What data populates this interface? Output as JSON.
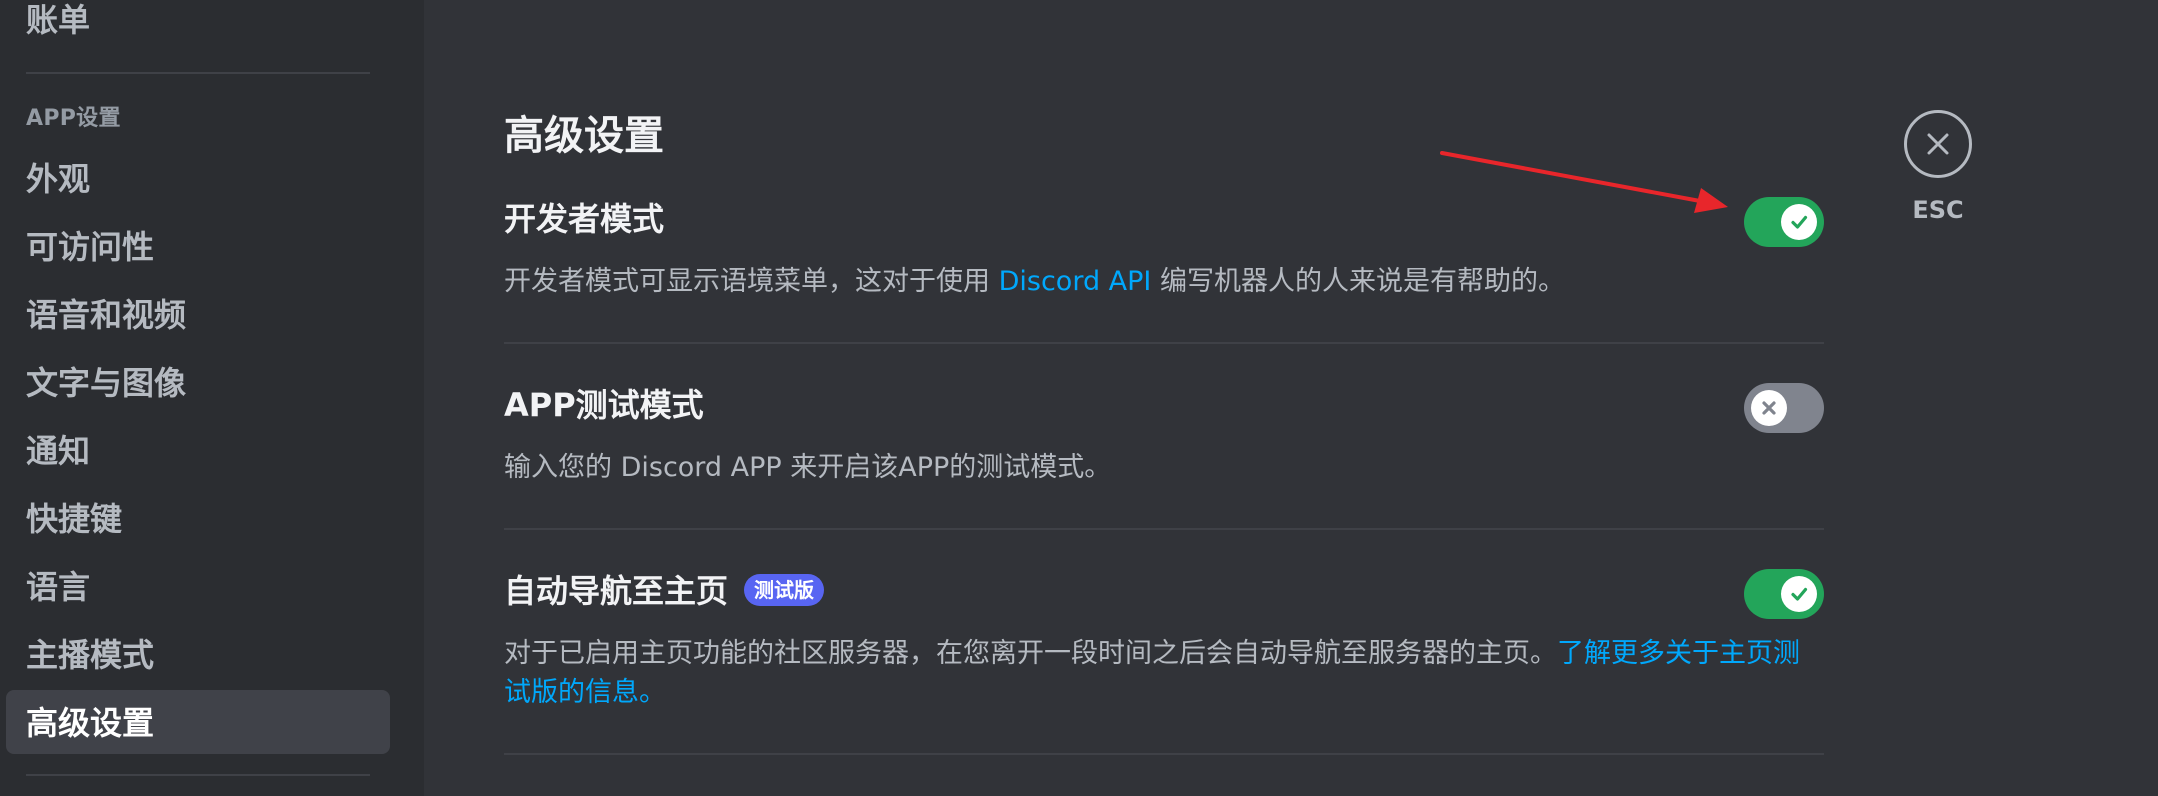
{
  "sidebar": {
    "top_item": "账单",
    "section_header": "APP设置",
    "items": [
      {
        "label": "外观"
      },
      {
        "label": "可访问性"
      },
      {
        "label": "语音和视频"
      },
      {
        "label": "文字与图像"
      },
      {
        "label": "通知"
      },
      {
        "label": "快捷键"
      },
      {
        "label": "语言"
      },
      {
        "label": "主播模式"
      },
      {
        "label": "高级设置",
        "active": true
      }
    ]
  },
  "main": {
    "title": "高级设置",
    "settings": [
      {
        "title": "开发者模式",
        "desc_before": "开发者模式可显示语境菜单，这对于使用 ",
        "desc_link": "Discord API",
        "desc_after": " 编写机器人的人来说是有帮助的。",
        "enabled": true
      },
      {
        "title": "APP测试模式",
        "desc": "输入您的 Discord APP 来开启该APP的测试模式。",
        "enabled": false
      },
      {
        "title": "自动导航至主页",
        "badge": "测试版",
        "desc_before": "对于已启用主页功能的社区服务器，在您离开一段时间之后会自动导航至服务器的主页。",
        "desc_link": "了解更多关于主页测试版的信息。",
        "enabled": true
      }
    ]
  },
  "close": {
    "label": "ESC",
    "icon": "close-icon"
  },
  "colors": {
    "background": "#313338",
    "sidebar": "#2b2d31",
    "toggle_on": "#23a55a",
    "toggle_off": "#80848e",
    "link": "#00a8fc",
    "badge": "#5865f2",
    "annotation_arrow": "#e8262b"
  }
}
